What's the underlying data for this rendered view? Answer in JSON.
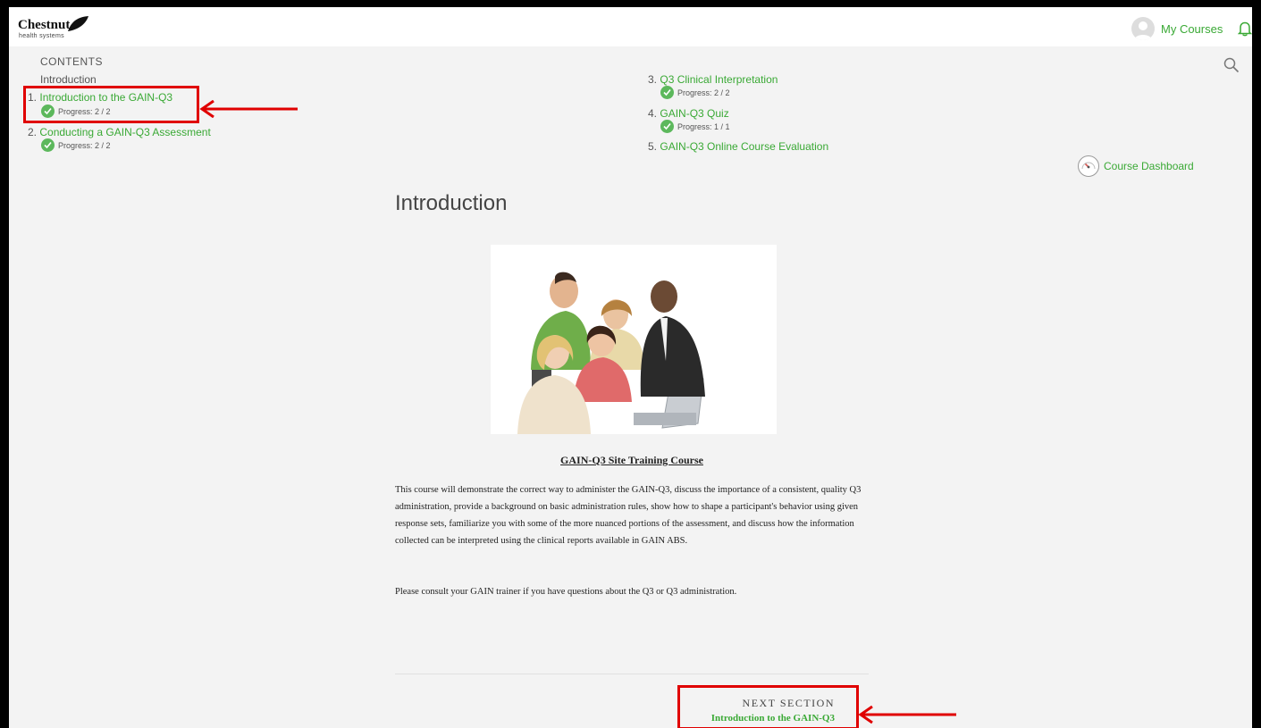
{
  "header": {
    "logo_brand": "Chestnut",
    "logo_sub": "health systems",
    "course_title": "GAIN-Q3 Site Training Course",
    "my_courses": "My Courses"
  },
  "contents": {
    "heading": "CONTENTS",
    "intro_label": "Introduction",
    "items": [
      {
        "num": "1.",
        "label": "Introduction to the GAIN-Q3",
        "progress": "Progress: 2 / 2"
      },
      {
        "num": "2.",
        "label": "Conducting a GAIN-Q3 Assessment",
        "progress": "Progress: 2 / 2"
      },
      {
        "num": "3.",
        "label": "Q3 Clinical Interpretation",
        "progress": "Progress: 2 / 2"
      },
      {
        "num": "4.",
        "label": "GAIN-Q3 Quiz",
        "progress": "Progress: 1 / 1"
      },
      {
        "num": "5.",
        "label": "GAIN-Q3 Online Course Evaluation"
      }
    ]
  },
  "course_dashboard": "Course Dashboard",
  "main": {
    "title": "Introduction",
    "subtitle": "GAIN-Q3 Site Training Course",
    "paragraph1": "This course will demonstrate the correct way to administer the GAIN-Q3, discuss the importance of a consistent, quality Q3 administration, provide a background on basic administration rules, show how to shape a participant's behavior using given response sets, familiarize you with some of the more nuanced portions of the assessment, and discuss how the information collected can be interpreted using the clinical reports available in GAIN ABS.",
    "paragraph2": "Please consult your GAIN trainer if you have questions about the Q3 or Q3 administration."
  },
  "next_section": {
    "label": "NEXT SECTION",
    "link": "Introduction to the GAIN-Q3"
  },
  "colors": {
    "accent": "#3aa935",
    "annotation": "#e00000",
    "check": "#5cb85c"
  }
}
